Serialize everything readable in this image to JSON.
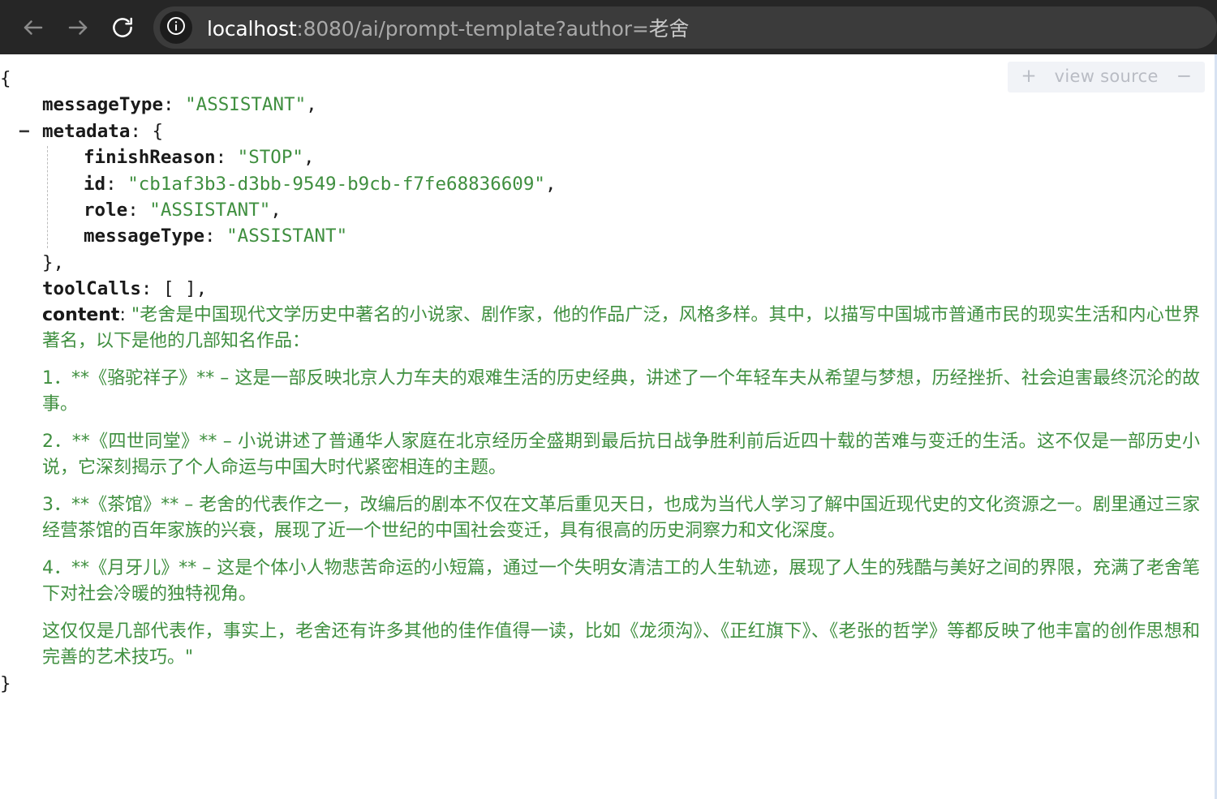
{
  "browser": {
    "back_icon": "arrow-left-icon",
    "forward_icon": "arrow-right-icon",
    "reload_icon": "reload-icon",
    "site_info_icon": "info-circle-icon",
    "url_host": "localhost",
    "url_path": ":8080/ai/prompt-template?author=",
    "url_param_value": "老舍",
    "url_full": "localhost:8080/ai/prompt-template?author=老舍"
  },
  "view_source": {
    "expand_label": "+",
    "label": "view source",
    "collapse_label": "−"
  },
  "json": {
    "open_brace": "{",
    "close_brace": "}",
    "message_type_key": "messageType",
    "message_type_value": "\"ASSISTANT\"",
    "metadata_key": "metadata",
    "metadata_open": "{",
    "metadata_close": "},",
    "collapse_toggle": "−",
    "finish_reason_key": "finishReason",
    "finish_reason_value": "\"STOP\"",
    "id_key": "id",
    "id_value": "\"cb1af3b3-d3bb-9549-b9cb-f7fe68836609\"",
    "role_key": "role",
    "role_value": "\"ASSISTANT\"",
    "meta_message_type_key": "messageType",
    "meta_message_type_value": "\"ASSISTANT\"",
    "tool_calls_key": "toolCalls",
    "tool_calls_value": "[ ],",
    "content_key": "content",
    "colon": ": ",
    "comma": ",",
    "content_paragraphs": [
      "\"老舍是中国现代文学历史中著名的小说家、剧作家，他的作品广泛，风格多样。其中，以描写中国城市普通市民的现实生活和内心世界著名，以下是他的几部知名作品：",
      "1．**《骆驼祥子》** – 这是一部反映北京人力车夫的艰难生活的历史经典，讲述了一个年轻车夫从希望与梦想，历经挫折、社会迫害最终沉沦的故事。",
      "2．**《四世同堂》** – 小说讲述了普通华人家庭在北京经历全盛期到最后抗日战争胜利前后近四十载的苦难与变迁的生活。这不仅是一部历史小说，它深刻揭示了个人命运与中国大时代紧密相连的主题。",
      "3．**《茶馆》** – 老舍的代表作之一，改编后的剧本不仅在文革后重见天日，也成为当代人学习了解中国近现代史的文化资源之一。剧里通过三家经营茶馆的百年家族的兴衰，展现了近一个世纪的中国社会变迁，具有很高的历史洞察力和文化深度。",
      "4．**《月牙儿》** – 这是个体小人物悲苦命运的小短篇，通过一个失明女清洁工的人生轨迹，展现了人生的残酷与美好之间的界限，充满了老舍笔下对社会冷暖的独特视角。",
      "这仅仅是几部代表作，事实上，老舍还有许多其他的佳作值得一读，比如《龙须沟》、《正红旗下》、《老张的哲学》等都反映了他丰富的创作思想和完善的艺术技巧。\""
    ]
  },
  "colors": {
    "chrome_bg": "#262626",
    "omnibox_bg": "#3b3b3b",
    "string_green": "#3f8f3f",
    "key_black": "#1a1a1a",
    "page_bg": "#ffffff"
  }
}
